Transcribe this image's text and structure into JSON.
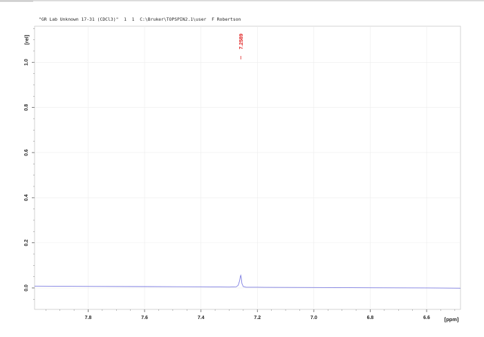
{
  "header": {
    "text": "\"GR Lab Unknown 17-31 (CDCl3)\"  1  1  C:\\Bruker\\TOPSPIN2.1\\user  F Robertson"
  },
  "colors": {
    "spectrum": "#7b7be0",
    "peak_label": "#e02020",
    "grid": "#ececec",
    "frame": "#c8c8c8"
  },
  "chart_data": {
    "type": "line",
    "title": "",
    "xlabel": "[ppm]",
    "ylabel": "[rel]",
    "x_reversed": true,
    "xlim": [
      7.99,
      6.48
    ],
    "ylim": [
      -0.095,
      1.16
    ],
    "x_ticks": [
      {
        "value": 7.8,
        "label": "7.8"
      },
      {
        "value": 7.6,
        "label": "7.6"
      },
      {
        "value": 7.4,
        "label": "7.4"
      },
      {
        "value": 7.2,
        "label": "7.2"
      },
      {
        "value": 7.0,
        "label": "7.0"
      },
      {
        "value": 6.8,
        "label": "6.8"
      },
      {
        "value": 6.6,
        "label": "6.6"
      }
    ],
    "y_ticks": [
      {
        "value": 0.0,
        "label": "0.0"
      },
      {
        "value": 0.2,
        "label": "0.2"
      },
      {
        "value": 0.4,
        "label": "0.4"
      },
      {
        "value": 0.6,
        "label": "0.6"
      },
      {
        "value": 0.8,
        "label": "0.8"
      },
      {
        "value": 1.0,
        "label": "1.0"
      }
    ],
    "grid": true,
    "series": [
      {
        "x": [
          7.99,
          7.8,
          7.6,
          7.4,
          7.3,
          7.275,
          7.268,
          7.263,
          7.2605,
          7.259,
          7.2575,
          7.255,
          7.25,
          7.24,
          7.2,
          7.0,
          6.8,
          6.6,
          6.48
        ],
        "y": [
          0.008,
          0.007,
          0.006,
          0.005,
          0.004,
          0.005,
          0.012,
          0.032,
          0.05,
          0.056,
          0.048,
          0.02,
          0.006,
          0.003,
          0.003,
          0.002,
          0.001,
          0.0,
          -0.001
        ]
      }
    ],
    "annotations": [
      {
        "x": 7.2589,
        "label": "7.2589"
      }
    ]
  }
}
